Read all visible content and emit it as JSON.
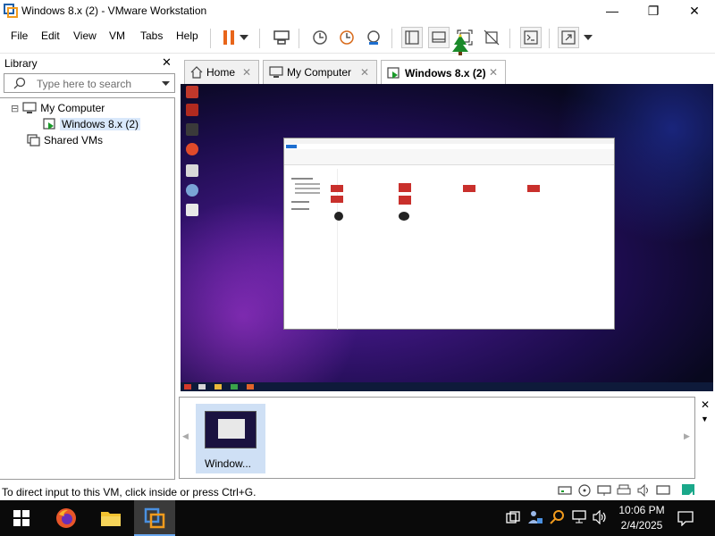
{
  "window": {
    "title": "Windows 8.x (2) - VMware Workstation",
    "minimize_glyph": "—",
    "maximize_glyph": "❐",
    "close_glyph": "✕"
  },
  "menu": {
    "items": [
      "File",
      "Edit",
      "View",
      "VM",
      "Tabs",
      "Help"
    ]
  },
  "library": {
    "title": "Library",
    "close_glyph": "✕",
    "search_placeholder": "Type here to search",
    "tree": {
      "root": "My Computer",
      "vm": "Windows 8.x (2)",
      "shared": "Shared VMs",
      "expand_glyph": "⊟"
    }
  },
  "tabs": [
    {
      "label": "Home",
      "icon": "home-icon"
    },
    {
      "label": "My Computer",
      "icon": "computer-icon"
    },
    {
      "label": "Windows 8.x (2)",
      "icon": "vm-running-icon"
    }
  ],
  "thumbnail": {
    "label": "Window..."
  },
  "status": {
    "message": "To direct input to this VM, click inside or press Ctrl+G."
  },
  "taskbar": {
    "time": "10:06 PM",
    "date": "2/4/2025"
  },
  "colors": {
    "accent": "#1e6fd0",
    "pause_orange": "#e8651a",
    "selection": "#d9e8fb",
    "taskbar": "#0a0a0a"
  }
}
